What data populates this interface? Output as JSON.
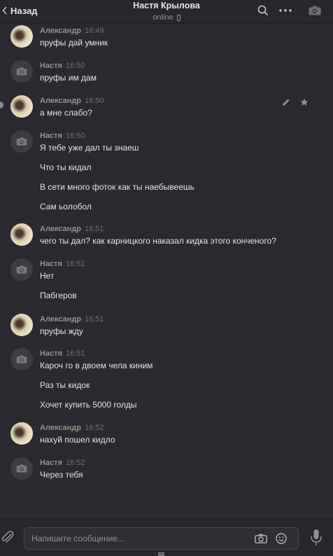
{
  "header": {
    "back_label": "Назад",
    "contact_name": "Настя Крылова",
    "status": "online"
  },
  "messages": [
    {
      "author": "Александр",
      "time": "16:49",
      "avatar": "alex",
      "lines": [
        "пруфы дай умник"
      ]
    },
    {
      "author": "Настя",
      "time": "16:50",
      "avatar": "nastya",
      "lines": [
        "пруфы им дам"
      ]
    },
    {
      "author": "Александр",
      "time": "16:50",
      "avatar": "alex",
      "lines": [
        "а мне слабо?"
      ]
    },
    {
      "author": "Настя",
      "time": "16:50",
      "avatar": "nastya",
      "lines": [
        "Я тебе уже дал ты знаеш",
        "Что ты кидал",
        "В сети много фоток как ты наебывеешь",
        "Сам ьолобол"
      ]
    },
    {
      "author": "Александр",
      "time": "16:51",
      "avatar": "alex",
      "lines": [
        "чего ты дал? как карницкого наказал кидка этого конченого?"
      ]
    },
    {
      "author": "Настя",
      "time": "16:51",
      "avatar": "nastya",
      "lines": [
        "Нет",
        "Пабгеров"
      ]
    },
    {
      "author": "Александр",
      "time": "16:51",
      "avatar": "alex",
      "lines": [
        "пруфы жду"
      ]
    },
    {
      "author": "Настя",
      "time": "16:51",
      "avatar": "nastya",
      "lines": [
        "Кароч го в двоем чела киним",
        "Раз ты кидок",
        "Хочет купить 5000 голды"
      ]
    },
    {
      "author": "Александр",
      "time": "16:52",
      "avatar": "alex",
      "lines": [
        "нахуй пошел кидло"
      ]
    },
    {
      "author": "Настя",
      "time": "16:52",
      "avatar": "nastya",
      "lines": [
        "Через тебя"
      ]
    }
  ],
  "composer": {
    "placeholder": "Напишите сообщение..."
  },
  "icons": {
    "back": "chevron-left-icon",
    "search": "search-icon",
    "more": "more-dots-icon",
    "camera": "camera-icon",
    "edit": "pencil-icon",
    "star": "star-icon",
    "attach": "paperclip-icon",
    "emoji": "smile-icon",
    "mic": "microphone-icon"
  },
  "colors": {
    "background": "#2b2b2f",
    "header": "#28282c",
    "text": "#e1e3e6",
    "author": "#939393",
    "time": "#6d6f74"
  }
}
